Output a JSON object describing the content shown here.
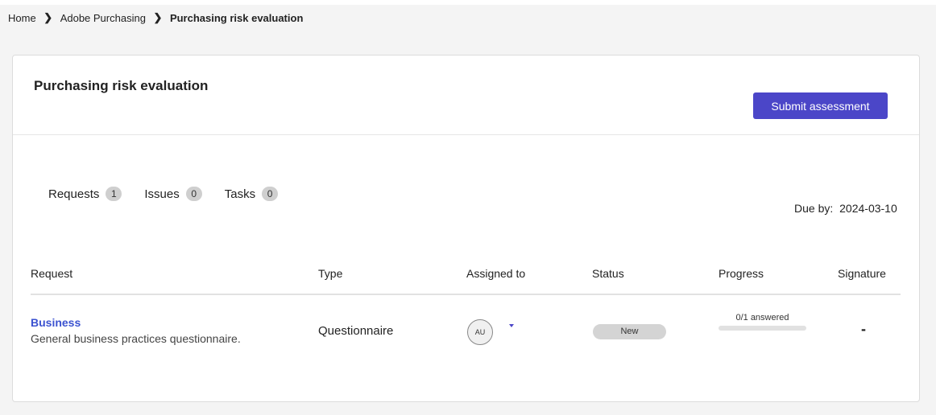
{
  "breadcrumb": {
    "items": [
      "Home",
      "Adobe Purchasing",
      "Purchasing risk evaluation"
    ]
  },
  "card": {
    "title": "Purchasing risk evaluation",
    "submit_label": "Submit assessment"
  },
  "tabs": [
    {
      "label": "Requests",
      "count": "1"
    },
    {
      "label": "Issues",
      "count": "0"
    },
    {
      "label": "Tasks",
      "count": "0"
    }
  ],
  "due": {
    "label": "Due by:",
    "date": "2024-03-10"
  },
  "table": {
    "columns": [
      "Request",
      "Type",
      "Assigned to",
      "Status",
      "Progress",
      "Signature"
    ],
    "rows": [
      {
        "name": "Business",
        "description": "General business practices questionnaire.",
        "type": "Questionnaire",
        "assignee_initials": "AU",
        "status": "New",
        "progress_text": "0/1 answered",
        "progress_fraction": 0,
        "signature": "-"
      }
    ]
  },
  "icons": {
    "separator": "chevron-right-icon",
    "assign_dropdown": "caret-down-icon"
  },
  "colors": {
    "accent": "#4b46c8",
    "link": "#3b52d0"
  }
}
